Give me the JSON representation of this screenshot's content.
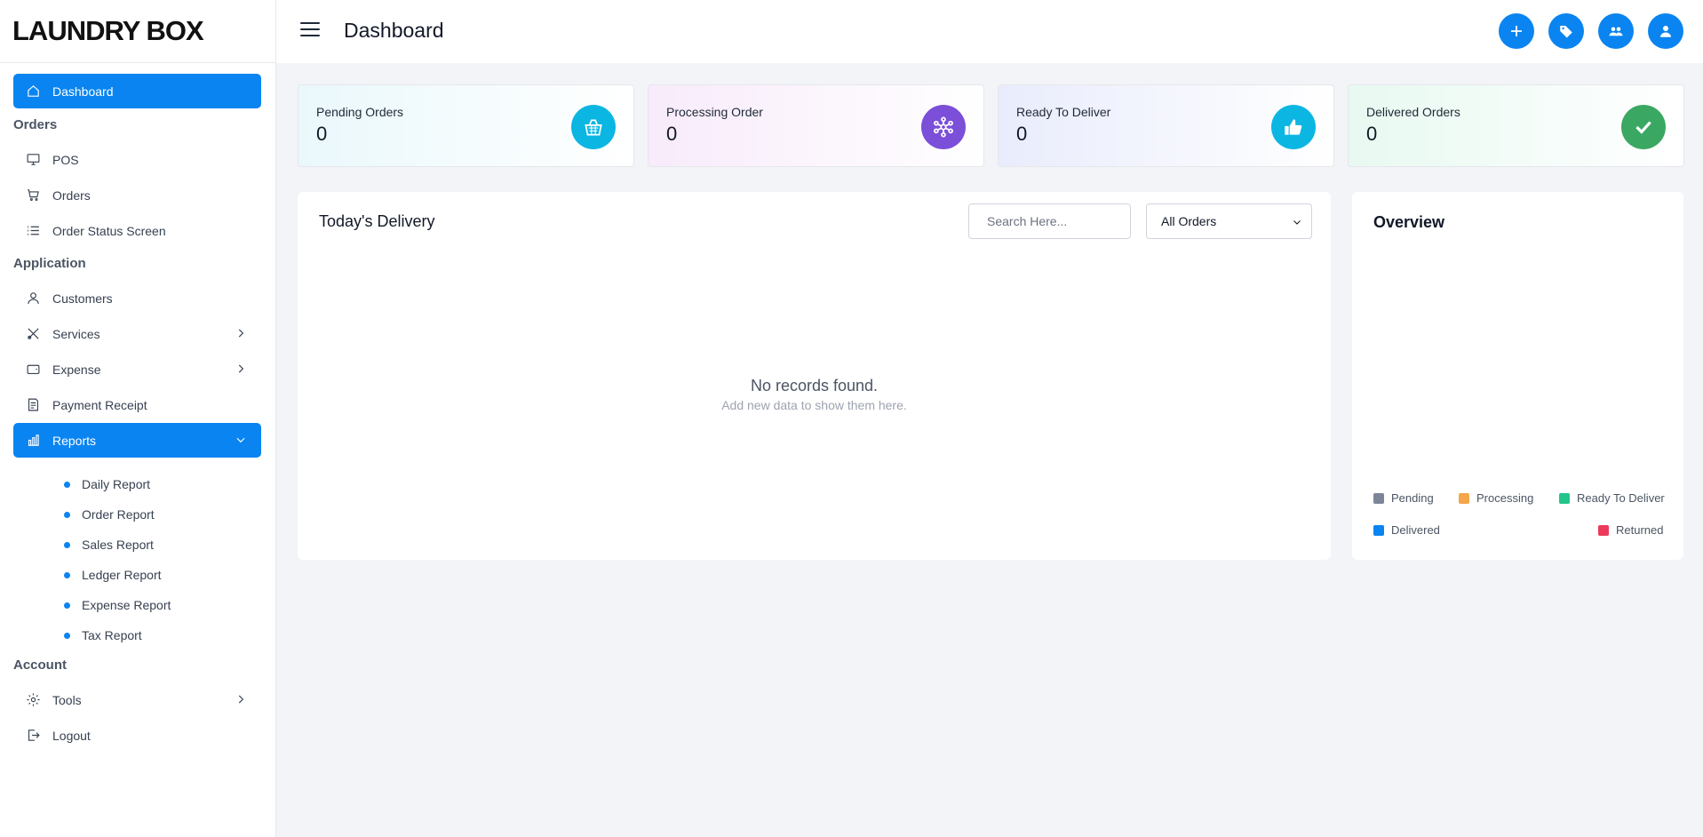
{
  "brand": "LAUNDRY BOX",
  "sidebar": {
    "sections": [
      "Orders",
      "Application",
      "Account"
    ],
    "items": [
      {
        "label": "Dashboard"
      },
      {
        "label": "POS"
      },
      {
        "label": "Orders"
      },
      {
        "label": "Order Status Screen"
      },
      {
        "label": "Customers"
      },
      {
        "label": "Services"
      },
      {
        "label": "Expense"
      },
      {
        "label": "Payment Receipt"
      },
      {
        "label": "Reports"
      },
      {
        "label": "Tools"
      },
      {
        "label": "Logout"
      }
    ],
    "reports": [
      "Daily Report",
      "Order Report",
      "Sales Report",
      "Ledger Report",
      "Expense Report",
      "Tax Report"
    ]
  },
  "header": {
    "title": "Dashboard"
  },
  "stats": [
    {
      "label": "Pending Orders",
      "value": "0",
      "icon": "basket-icon",
      "color": "#0bb6e3"
    },
    {
      "label": "Processing Order",
      "value": "0",
      "icon": "network-icon",
      "color": "#7b4fd8"
    },
    {
      "label": "Ready To Deliver",
      "value": "0",
      "icon": "thumbs-up-icon",
      "color": "#0bb6e3"
    },
    {
      "label": "Delivered Orders",
      "value": "0",
      "icon": "check-icon",
      "color": "#3aa862"
    }
  ],
  "delivery": {
    "title": "Today's Delivery",
    "search_placeholder": "Search Here...",
    "filter_value": "All Orders",
    "empty_title": "No records found.",
    "empty_sub": "Add new data to show them here."
  },
  "overview": {
    "title": "Overview",
    "legend": [
      {
        "label": "Pending",
        "color": "#7c8698"
      },
      {
        "label": "Processing",
        "color": "#f5a54a"
      },
      {
        "label": "Ready To Deliver",
        "color": "#22c58b"
      },
      {
        "label": "Delivered",
        "color": "#0a84f0"
      },
      {
        "label": "Returned",
        "color": "#ec3a5b"
      }
    ]
  }
}
